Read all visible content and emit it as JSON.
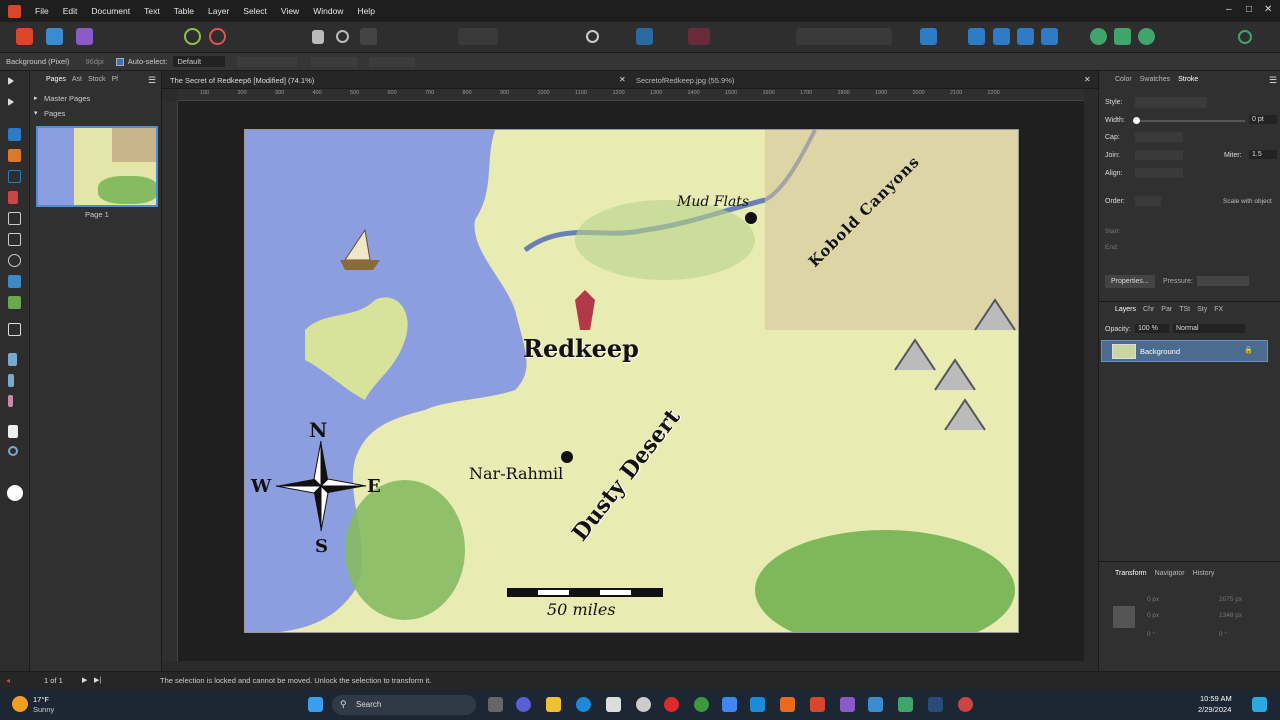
{
  "menu": {
    "items": [
      "File",
      "Edit",
      "Document",
      "Text",
      "Table",
      "Layer",
      "Select",
      "View",
      "Window",
      "Help"
    ],
    "window_controls": {
      "minimize": "–",
      "maximize": "□",
      "close": "✕"
    }
  },
  "context_bar": {
    "layer_type": "Background (Pixel)",
    "dpi": "96dpi",
    "autoselect_label": "Auto-select:",
    "autoselect_value": "Default"
  },
  "pages_panel": {
    "tabs": [
      "Pages",
      "Ast",
      "Stock",
      "Pf"
    ],
    "master_pages_label": "Master Pages",
    "pages_label": "Pages",
    "page_caption": "Page 1"
  },
  "document_tabs": [
    {
      "title": "The Secret of Redkeep6 [Modified] (74.1%)"
    },
    {
      "title": "SecretofRedkeep.jpg (55.9%)"
    }
  ],
  "ruler_ticks": [
    "100",
    "200",
    "300",
    "400",
    "500",
    "600",
    "700",
    "800",
    "900",
    "1000",
    "1100",
    "1200",
    "1300",
    "1400",
    "1500",
    "1600",
    "1700",
    "1800",
    "1900",
    "2000",
    "2100",
    "2200"
  ],
  "map": {
    "labels": {
      "redkeep": "Redkeep",
      "mud_flats": "Mud Flats",
      "kobold_canyons": "Kobold Canyons",
      "nar_rahmil": "Nar-Rahmil",
      "dusty_desert": "Dusty Desert",
      "scale": "50 miles",
      "compass_n": "N",
      "compass_s": "S",
      "compass_e": "E",
      "compass_w": "W"
    },
    "colors": {
      "water": "#8c9de0",
      "land": "#e9ecb4",
      "forest": "#7fb85a"
    }
  },
  "right_panel": {
    "top_tabs": [
      "Color",
      "Swatches",
      "Stroke"
    ],
    "style_label": "Style:",
    "width_label": "Width:",
    "width_value": "0 pt",
    "cap_label": "Cap:",
    "join_label": "Join:",
    "miter_label": "Miter:",
    "miter_value": "1.5",
    "align_label": "Align:",
    "order_label": "Order:",
    "scale_with_object": "Scale with object",
    "start_label": "Start:",
    "end_label": "End:",
    "properties_button": "Properties...",
    "pressure_label": "Pressure:",
    "layer_tabs": [
      "Layers",
      "Chr",
      "Par",
      "TSt",
      "Sty",
      "FX"
    ],
    "opacity_label": "Opacity:",
    "opacity_value": "100 %",
    "blend_mode": "Normal",
    "layer_name": "Background",
    "bottom_tabs": [
      "Transform",
      "Navigator",
      "History"
    ],
    "transform": {
      "x": "0 px",
      "y": "0 px",
      "w": "2075 px",
      "h": "1348 px",
      "r": "0 °",
      "s": "0 °"
    }
  },
  "status": {
    "page_counter": "1 of 1",
    "message": "The selection is locked and cannot be moved. Unlock the selection to transform it."
  },
  "taskbar": {
    "weather_temp": "17°F",
    "weather_desc": "Sunny",
    "search_label": "Search",
    "time": "10:59 AM",
    "date": "2/29/2024"
  }
}
